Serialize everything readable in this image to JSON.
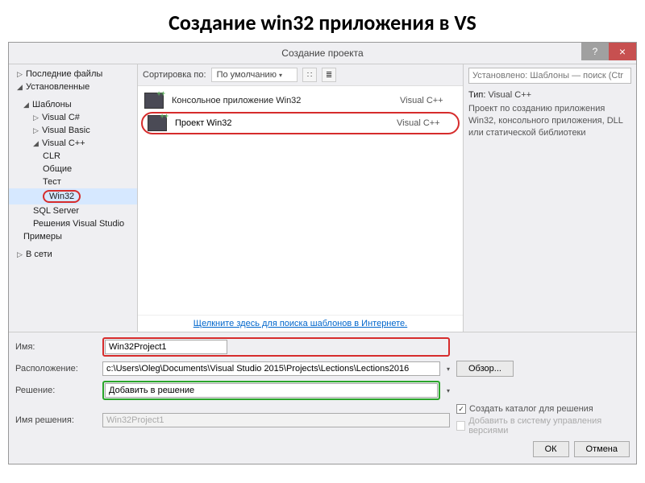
{
  "slide_title": "Создание win32 приложения в VS",
  "dialog": {
    "title": "Создание проекта",
    "help": "?",
    "close": "×"
  },
  "sidebar": {
    "recent": "Последние файлы",
    "installed": "Установленные",
    "templates": "Шаблоны",
    "csharp": "Visual C#",
    "vb": "Visual Basic",
    "vcpp": "Visual C++",
    "clr": "CLR",
    "common": "Общие",
    "test": "Тест",
    "win32": "Win32",
    "sql": "SQL Server",
    "vsol": "Решения Visual Studio",
    "examples": "Примеры",
    "online": "В сети"
  },
  "toolbar": {
    "sort_label": "Сортировка по:",
    "sort_value": "По умолчанию"
  },
  "search": {
    "placeholder": "Установлено: Шаблоны — поиск (Ctr"
  },
  "templates": [
    {
      "name": "Консольное приложение Win32",
      "lang": "Visual C++"
    },
    {
      "name": "Проект Win32",
      "lang": "Visual C++"
    }
  ],
  "right": {
    "type_label": "Тип:",
    "type_value": "Visual C++",
    "desc": "Проект по созданию приложения Win32, консольного приложения, DLL или статической библиотеки"
  },
  "online_link": "Щелкните здесь для поиска шаблонов в Интернете.",
  "form": {
    "name_label": "Имя:",
    "name_value": "Win32Project1",
    "location_label": "Расположение:",
    "location_value": "c:\\Users\\Oleg\\Documents\\Visual Studio 2015\\Projects\\Lections\\Lections2016",
    "solution_label": "Решение:",
    "solution_value": "Добавить в решение",
    "solname_label": "Имя решения:",
    "solname_value": "Win32Project1",
    "browse": "Обзор...",
    "chk_createdir": "Создать каталог для решения",
    "chk_versioncontrol": "Добавить в систему управления версиями",
    "ok": "ОК",
    "cancel": "Отмена"
  }
}
